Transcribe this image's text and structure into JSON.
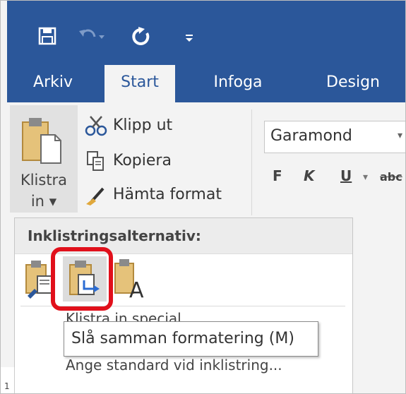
{
  "quick_access": {
    "save_icon": "floppy-disk-icon",
    "undo_icon": "undo-icon",
    "redo_icon": "redo-icon",
    "customize_icon": "customize-toolbar-icon"
  },
  "tabs": [
    {
      "label": "Arkiv",
      "active": false
    },
    {
      "label": "Start",
      "active": true
    },
    {
      "label": "Infoga",
      "active": false
    },
    {
      "label": "Design",
      "active": false
    }
  ],
  "clipboard": {
    "paste_label_line1": "Klistra",
    "paste_label_line2": "in ▾",
    "cut_label": "Klipp ut",
    "copy_label": "Kopiera",
    "format_painter_label": "Hämta format"
  },
  "font": {
    "font_name": "Garamond",
    "bold_label": "F",
    "italic_label": "K",
    "underline_label": "U",
    "dropdown_glyph": "▾",
    "strike_label": "abc"
  },
  "paste_menu": {
    "header": "Inklistringsalternativ:",
    "options": [
      {
        "name": "keep-source-formatting",
        "icon": "paste-keep-source-icon"
      },
      {
        "name": "merge-formatting",
        "icon": "paste-merge-formatting-icon",
        "highlighted": true
      },
      {
        "name": "keep-text-only",
        "icon": "paste-text-only-icon"
      }
    ],
    "paste_special_label": "Klistra in special...",
    "set_default_label": "Ange standard vid inklistring..."
  },
  "tooltip": {
    "text": "Slå samman formatering (M)"
  },
  "colors": {
    "brand_blue": "#2b579a",
    "highlight_red": "#e1101b"
  }
}
